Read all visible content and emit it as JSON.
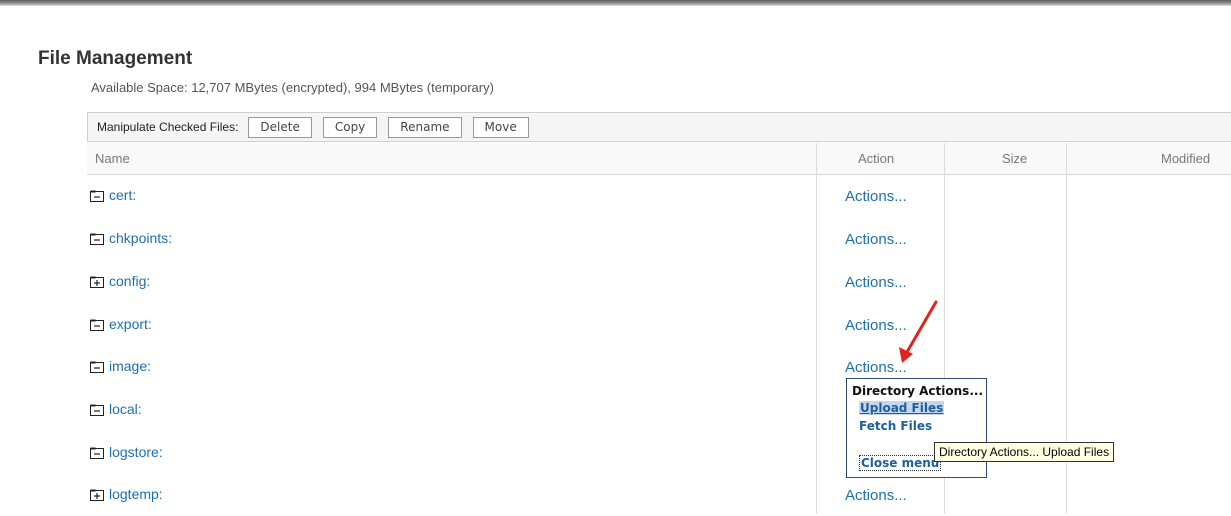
{
  "page": {
    "title": "File Management",
    "available_space": "Available Space: 12,707 MBytes (encrypted), 994 MBytes (temporary)"
  },
  "toolbar": {
    "label": "Manipulate Checked Files:",
    "buttons": [
      "Delete",
      "Copy",
      "Rename",
      "Move"
    ]
  },
  "table": {
    "headers": {
      "name": "Name",
      "action": "Action",
      "size": "Size",
      "modified": "Modified"
    },
    "rows": [
      {
        "name": "cert:",
        "action": "Actions...",
        "folder_state": "collapsed"
      },
      {
        "name": "chkpoints:",
        "action": "Actions...",
        "folder_state": "collapsed"
      },
      {
        "name": "config:",
        "action": "Actions...",
        "folder_state": "expandable"
      },
      {
        "name": "export:",
        "action": "Actions...",
        "folder_state": "collapsed"
      },
      {
        "name": "image:",
        "action": "Actions...",
        "folder_state": "collapsed"
      },
      {
        "name": "local:",
        "action": "",
        "folder_state": "collapsed"
      },
      {
        "name": "logstore:",
        "action": "",
        "folder_state": "collapsed"
      },
      {
        "name": "logtemp:",
        "action": "Actions...",
        "folder_state": "expandable"
      }
    ]
  },
  "context_menu": {
    "heading": "Directory Actions...",
    "items": [
      "Upload Files",
      "Fetch Files"
    ],
    "close": "Close menu"
  },
  "tooltip": "Directory Actions... Upload Files",
  "colors": {
    "link": "#1d6fb3",
    "annotation_arrow": "#e0241b"
  }
}
